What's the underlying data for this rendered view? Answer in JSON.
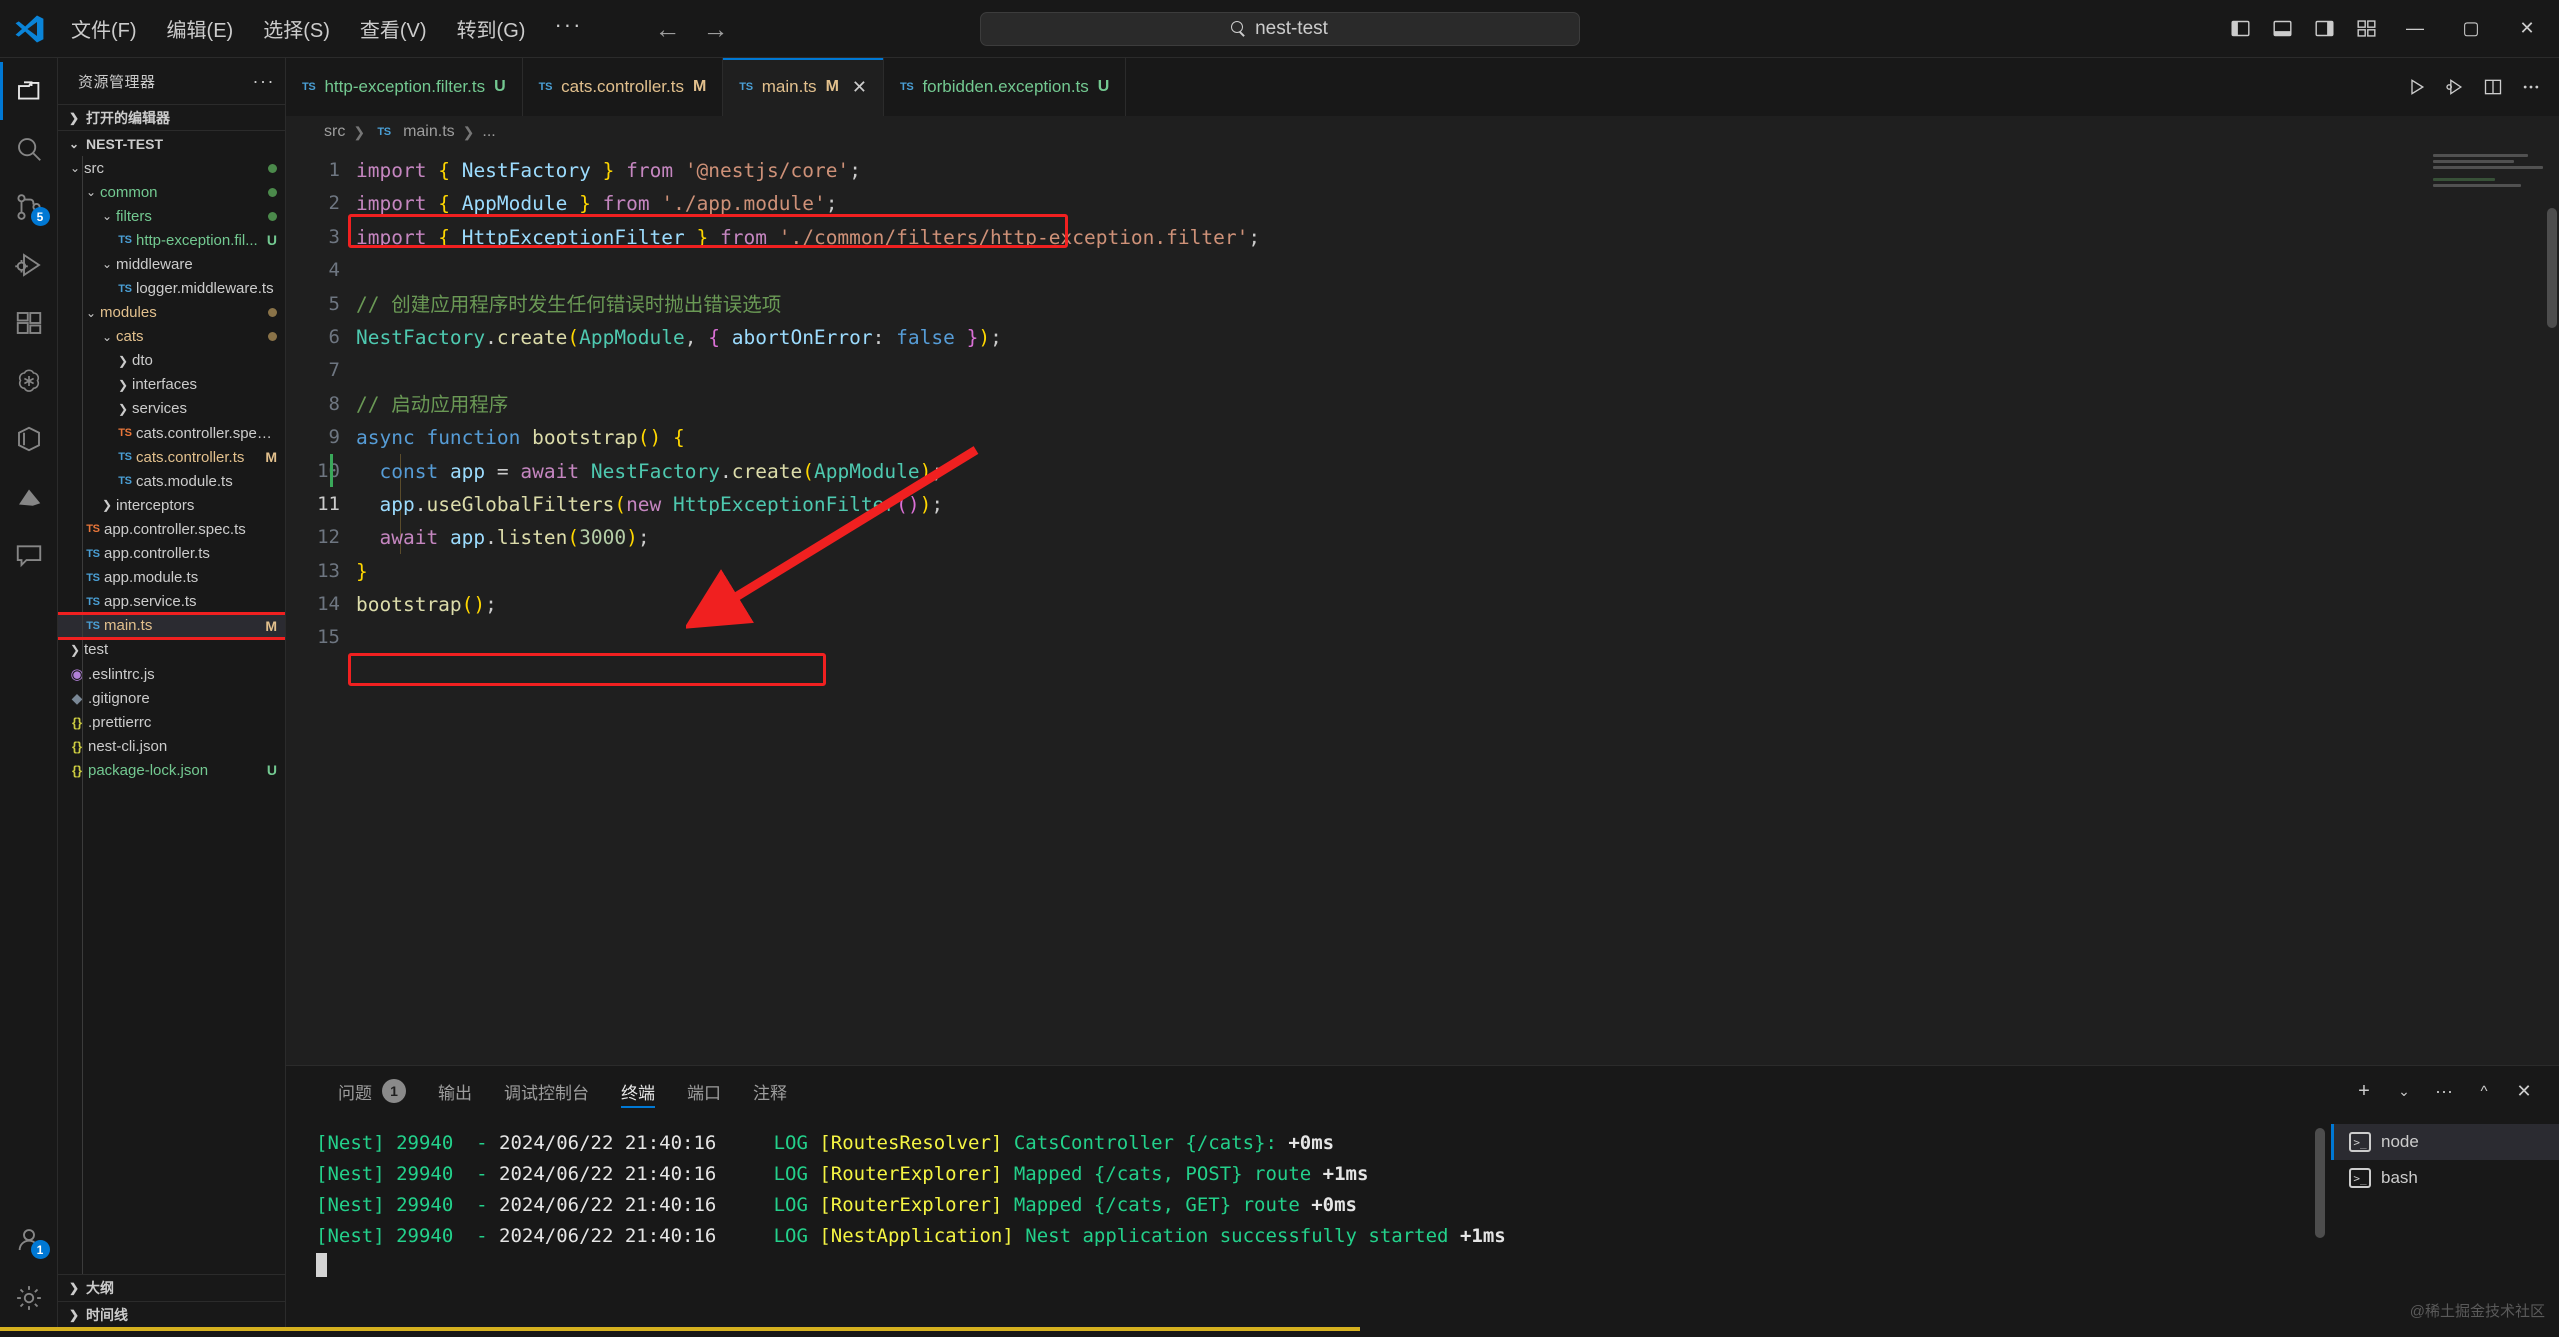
{
  "titlebar": {
    "menus": [
      "文件(F)",
      "编辑(E)",
      "选择(S)",
      "查看(V)",
      "转到(G)"
    ],
    "more": "···",
    "back_icon": "←",
    "forward_icon": "→",
    "command_center_text": "nest-test",
    "search_icon": "search-icon",
    "window_minimize": "—",
    "window_maximize": "▢",
    "window_close": "✕"
  },
  "activitybar": {
    "items": [
      {
        "name": "explorer",
        "icon": "files-icon",
        "active": true,
        "badge": ""
      },
      {
        "name": "search",
        "icon": "search-icon",
        "active": false,
        "badge": ""
      },
      {
        "name": "source-control",
        "icon": "source-control-icon",
        "active": false,
        "badge": "5"
      },
      {
        "name": "run-and-debug",
        "icon": "debug-icon",
        "active": false,
        "badge": ""
      },
      {
        "name": "extensions",
        "icon": "extensions-icon",
        "active": false,
        "badge": ""
      },
      {
        "name": "chatgpt",
        "icon": "openai-icon",
        "active": false,
        "badge": ""
      },
      {
        "name": "docker",
        "icon": "cube-icon",
        "active": false,
        "badge": ""
      },
      {
        "name": "nest",
        "icon": "nest-icon",
        "active": false,
        "badge": ""
      },
      {
        "name": "comments",
        "icon": "comment-icon",
        "active": false,
        "badge": ""
      }
    ],
    "bottom": [
      {
        "name": "accounts",
        "icon": "account-icon",
        "badge": "1"
      },
      {
        "name": "settings",
        "icon": "gear-icon",
        "badge": ""
      }
    ]
  },
  "sidebar": {
    "title": "资源管理器",
    "more_icon": "···",
    "open_editors_label": "打开的编辑器",
    "project_label": "NEST-TEST",
    "outline_label": "大纲",
    "timeline_label": "时间线",
    "tree": [
      {
        "label": "src",
        "depth": 1,
        "type": "folder",
        "open": true,
        "dot": "#4b8a4b",
        "badge": ""
      },
      {
        "label": "common",
        "depth": 2,
        "type": "folder",
        "open": true,
        "dot": "#4b8a4b",
        "badge": "",
        "color": "#73c991"
      },
      {
        "label": "filters",
        "depth": 3,
        "type": "folder",
        "open": true,
        "dot": "#4b8a4b",
        "badge": "",
        "color": "#73c991"
      },
      {
        "label": "http-exception.fil...",
        "depth": 4,
        "type": "ts",
        "badge": "U",
        "color": "#73c991",
        "badge_color": "#73c991"
      },
      {
        "label": "middleware",
        "depth": 3,
        "type": "folder",
        "open": true,
        "badge": ""
      },
      {
        "label": "logger.middleware.ts",
        "depth": 4,
        "type": "ts",
        "badge": ""
      },
      {
        "label": "modules",
        "depth": 2,
        "type": "folder",
        "open": true,
        "dot": "#8a7348",
        "badge": "",
        "color": "#e2c08d"
      },
      {
        "label": "cats",
        "depth": 3,
        "type": "folder",
        "open": true,
        "dot": "#8a7348",
        "badge": "",
        "color": "#e2c08d"
      },
      {
        "label": "dto",
        "depth": 4,
        "type": "folder",
        "open": false,
        "badge": ""
      },
      {
        "label": "interfaces",
        "depth": 4,
        "type": "folder",
        "open": false,
        "badge": ""
      },
      {
        "label": "services",
        "depth": 4,
        "type": "folder",
        "open": false,
        "badge": ""
      },
      {
        "label": "cats.controller.spec.ts",
        "depth": 4,
        "type": "ts-spec",
        "badge": ""
      },
      {
        "label": "cats.controller.ts",
        "depth": 4,
        "type": "ts",
        "badge": "M",
        "color": "#e2c08d",
        "badge_color": "#e2c08d"
      },
      {
        "label": "cats.module.ts",
        "depth": 4,
        "type": "ts",
        "badge": ""
      },
      {
        "label": "interceptors",
        "depth": 3,
        "type": "folder",
        "open": false,
        "badge": ""
      },
      {
        "label": "app.controller.spec.ts",
        "depth": 2,
        "type": "ts-spec",
        "badge": ""
      },
      {
        "label": "app.controller.ts",
        "depth": 2,
        "type": "ts",
        "badge": ""
      },
      {
        "label": "app.module.ts",
        "depth": 2,
        "type": "ts",
        "badge": ""
      },
      {
        "label": "app.service.ts",
        "depth": 2,
        "type": "ts",
        "badge": ""
      },
      {
        "label": "main.ts",
        "depth": 2,
        "type": "ts",
        "badge": "M",
        "color": "#e2c08d",
        "badge_color": "#e2c08d",
        "selected": true,
        "highlighted": true
      },
      {
        "label": "test",
        "depth": 1,
        "type": "folder",
        "open": false,
        "badge": ""
      },
      {
        "label": ".eslintrc.js",
        "depth": 1,
        "type": "eslint",
        "badge": ""
      },
      {
        "label": ".gitignore",
        "depth": 1,
        "type": "git",
        "badge": ""
      },
      {
        "label": ".prettierrc",
        "depth": 1,
        "type": "json",
        "badge": ""
      },
      {
        "label": "nest-cli.json",
        "depth": 1,
        "type": "json",
        "badge": ""
      },
      {
        "label": "package-lock.json",
        "depth": 1,
        "type": "json",
        "badge": "U",
        "color": "#73c991",
        "badge_color": "#73c991"
      }
    ]
  },
  "editor": {
    "tabs": [
      {
        "label": "http-exception.filter.ts",
        "badge": "U",
        "active": false,
        "color": "#73c991",
        "icon": "ts-icon"
      },
      {
        "label": "cats.controller.ts",
        "badge": "M",
        "active": false,
        "color": "#e2c08d",
        "icon": "ts-icon"
      },
      {
        "label": "main.ts",
        "badge": "M",
        "active": true,
        "color": "#e2c08d",
        "icon": "ts-icon",
        "close": "✕"
      },
      {
        "label": "forbidden.exception.ts",
        "badge": "U",
        "active": false,
        "color": "#73c991",
        "icon": "ts-icon"
      }
    ],
    "actions": [
      {
        "name": "run-file",
        "icon": "play-icon"
      },
      {
        "name": "run-and-debug",
        "icon": "debug-alt-icon"
      },
      {
        "name": "split-editor",
        "icon": "split-editor-icon"
      },
      {
        "name": "more-actions",
        "icon": "ellipsis-icon"
      }
    ],
    "breadcrumb": [
      "src",
      "main.ts",
      "..."
    ],
    "breadcrumb_file_icon": "ts-icon",
    "line_numbers": [
      "1",
      "2",
      "3",
      "4",
      "5",
      "6",
      "7",
      "8",
      "9",
      "10",
      "11",
      "12",
      "13",
      "14",
      "15"
    ],
    "current_line": 11,
    "code_lines": [
      {
        "n": 1,
        "tokens": [
          {
            "t": "import",
            "c": "kw"
          },
          {
            "t": " ",
            "c": "op"
          },
          {
            "t": "{",
            "c": "p1"
          },
          {
            "t": " ",
            "c": "op"
          },
          {
            "t": "NestFactory",
            "c": "var"
          },
          {
            "t": " ",
            "c": "op"
          },
          {
            "t": "}",
            "c": "p1"
          },
          {
            "t": " ",
            "c": "op"
          },
          {
            "t": "from",
            "c": "kw"
          },
          {
            "t": " ",
            "c": "op"
          },
          {
            "t": "'@nestjs/core'",
            "c": "str"
          },
          {
            "t": ";",
            "c": "op"
          }
        ]
      },
      {
        "n": 2,
        "tokens": [
          {
            "t": "import",
            "c": "kw"
          },
          {
            "t": " ",
            "c": "op"
          },
          {
            "t": "{",
            "c": "p1"
          },
          {
            "t": " ",
            "c": "op"
          },
          {
            "t": "AppModule",
            "c": "var"
          },
          {
            "t": " ",
            "c": "op"
          },
          {
            "t": "}",
            "c": "p1"
          },
          {
            "t": " ",
            "c": "op"
          },
          {
            "t": "from",
            "c": "kw"
          },
          {
            "t": " ",
            "c": "op"
          },
          {
            "t": "'./app.module'",
            "c": "str"
          },
          {
            "t": ";",
            "c": "op"
          }
        ]
      },
      {
        "n": 3,
        "tokens": [
          {
            "t": "import",
            "c": "kw"
          },
          {
            "t": " ",
            "c": "op"
          },
          {
            "t": "{",
            "c": "p1"
          },
          {
            "t": " ",
            "c": "op"
          },
          {
            "t": "HttpExceptionFilter",
            "c": "var"
          },
          {
            "t": " ",
            "c": "op"
          },
          {
            "t": "}",
            "c": "p1"
          },
          {
            "t": " ",
            "c": "op"
          },
          {
            "t": "from",
            "c": "kw"
          },
          {
            "t": " ",
            "c": "op"
          },
          {
            "t": "'./common/filters/http-exception.filter'",
            "c": "str"
          },
          {
            "t": ";",
            "c": "op"
          }
        ]
      },
      {
        "n": 4,
        "tokens": []
      },
      {
        "n": 5,
        "tokens": [
          {
            "t": "// 创建应用程序时发生任何错误时抛出错误选项",
            "c": "cmt"
          }
        ]
      },
      {
        "n": 6,
        "tokens": [
          {
            "t": "NestFactory",
            "c": "cls"
          },
          {
            "t": ".",
            "c": "op"
          },
          {
            "t": "create",
            "c": "fn"
          },
          {
            "t": "(",
            "c": "p1"
          },
          {
            "t": "AppModule",
            "c": "cls"
          },
          {
            "t": ", ",
            "c": "op"
          },
          {
            "t": "{",
            "c": "p2"
          },
          {
            "t": " ",
            "c": "op"
          },
          {
            "t": "abortOnError",
            "c": "var"
          },
          {
            "t": ": ",
            "c": "op"
          },
          {
            "t": "false",
            "c": "kw2"
          },
          {
            "t": " ",
            "c": "op"
          },
          {
            "t": "}",
            "c": "p2"
          },
          {
            "t": ")",
            "c": "p1"
          },
          {
            "t": ";",
            "c": "op"
          }
        ]
      },
      {
        "n": 7,
        "tokens": []
      },
      {
        "n": 8,
        "tokens": [
          {
            "t": "// 启动应用程序",
            "c": "cmt"
          }
        ]
      },
      {
        "n": 9,
        "tokens": [
          {
            "t": "async",
            "c": "kw2"
          },
          {
            "t": " ",
            "c": "op"
          },
          {
            "t": "function",
            "c": "kw2"
          },
          {
            "t": " ",
            "c": "op"
          },
          {
            "t": "bootstrap",
            "c": "fn"
          },
          {
            "t": "(",
            "c": "p1"
          },
          {
            "t": ")",
            "c": "p1"
          },
          {
            "t": " ",
            "c": "op"
          },
          {
            "t": "{",
            "c": "p1"
          }
        ]
      },
      {
        "n": 10,
        "tokens": [
          {
            "t": "  ",
            "c": "op"
          },
          {
            "t": "const",
            "c": "kw2"
          },
          {
            "t": " ",
            "c": "op"
          },
          {
            "t": "app",
            "c": "var"
          },
          {
            "t": " ",
            "c": "op"
          },
          {
            "t": "=",
            "c": "op"
          },
          {
            "t": " ",
            "c": "op"
          },
          {
            "t": "await",
            "c": "kw"
          },
          {
            "t": " ",
            "c": "op"
          },
          {
            "t": "NestFactory",
            "c": "cls"
          },
          {
            "t": ".",
            "c": "op"
          },
          {
            "t": "create",
            "c": "fn"
          },
          {
            "t": "(",
            "c": "p1"
          },
          {
            "t": "AppModule",
            "c": "cls"
          },
          {
            "t": ")",
            "c": "p1"
          },
          {
            "t": ";",
            "c": "op"
          }
        ]
      },
      {
        "n": 11,
        "tokens": [
          {
            "t": "  ",
            "c": "op"
          },
          {
            "t": "app",
            "c": "var"
          },
          {
            "t": ".",
            "c": "op"
          },
          {
            "t": "useGlobalFilters",
            "c": "fn"
          },
          {
            "t": "(",
            "c": "p1"
          },
          {
            "t": "new",
            "c": "kw"
          },
          {
            "t": " ",
            "c": "op"
          },
          {
            "t": "HttpExceptionFilter",
            "c": "cls"
          },
          {
            "t": "(",
            "c": "p2"
          },
          {
            "t": ")",
            "c": "p2"
          },
          {
            "t": ")",
            "c": "p1"
          },
          {
            "t": ";",
            "c": "op"
          }
        ]
      },
      {
        "n": 12,
        "tokens": [
          {
            "t": "  ",
            "c": "op"
          },
          {
            "t": "await",
            "c": "kw"
          },
          {
            "t": " ",
            "c": "op"
          },
          {
            "t": "app",
            "c": "var"
          },
          {
            "t": ".",
            "c": "op"
          },
          {
            "t": "listen",
            "c": "fn"
          },
          {
            "t": "(",
            "c": "p1"
          },
          {
            "t": "3000",
            "c": "num"
          },
          {
            "t": ")",
            "c": "p1"
          },
          {
            "t": ";",
            "c": "op"
          }
        ]
      },
      {
        "n": 13,
        "tokens": [
          {
            "t": "}",
            "c": "p1"
          }
        ]
      },
      {
        "n": 14,
        "tokens": [
          {
            "t": "bootstrap",
            "c": "fn"
          },
          {
            "t": "(",
            "c": "p1"
          },
          {
            "t": ")",
            "c": "p1"
          },
          {
            "t": ";",
            "c": "op"
          }
        ]
      },
      {
        "n": 15,
        "tokens": []
      }
    ],
    "annotations": {
      "highlight_boxes": [
        "import-httpexceptionfilter-line3",
        "useglobalfilters-line11",
        "main-ts-sidebar-entry"
      ],
      "arrow": "red-arrow-pointing-to-line11"
    }
  },
  "panel": {
    "tabs": [
      {
        "label": "问题",
        "count": "1",
        "active": false
      },
      {
        "label": "输出",
        "count": "",
        "active": false
      },
      {
        "label": "调试控制台",
        "count": "",
        "active": false
      },
      {
        "label": "终端",
        "count": "",
        "active": true
      },
      {
        "label": "端口",
        "count": "",
        "active": false
      },
      {
        "label": "注释",
        "count": "",
        "active": false
      }
    ],
    "actions": [
      {
        "name": "new-terminal",
        "icon": "plus-icon"
      },
      {
        "name": "terminal-dropdown",
        "icon": "chevron-down-icon"
      },
      {
        "name": "panel-more",
        "icon": "ellipsis-icon"
      },
      {
        "name": "maximize-panel",
        "icon": "chevron-up-icon"
      },
      {
        "name": "close-panel",
        "icon": "close-icon"
      }
    ],
    "terminal_lines": [
      {
        "segments": [
          {
            "t": "[Nest] 29940  - ",
            "c": "t-green"
          },
          {
            "t": "2024/06/22 21:40:16",
            "c": "t-white"
          },
          {
            "t": "     ",
            "c": "t-white"
          },
          {
            "t": "LOG ",
            "c": "t-green"
          },
          {
            "t": "[RoutesResolver] ",
            "c": "t-yellow"
          },
          {
            "t": "CatsController {/cats}: ",
            "c": "t-green"
          },
          {
            "t": "+0ms",
            "c": "t-white t-bold"
          }
        ]
      },
      {
        "segments": [
          {
            "t": "[Nest] 29940  - ",
            "c": "t-green"
          },
          {
            "t": "2024/06/22 21:40:16",
            "c": "t-white"
          },
          {
            "t": "     ",
            "c": "t-white"
          },
          {
            "t": "LOG ",
            "c": "t-green"
          },
          {
            "t": "[RouterExplorer] ",
            "c": "t-yellow"
          },
          {
            "t": "Mapped {/cats, POST} route ",
            "c": "t-green"
          },
          {
            "t": "+1ms",
            "c": "t-white t-bold"
          }
        ]
      },
      {
        "segments": [
          {
            "t": "[Nest] 29940  - ",
            "c": "t-green"
          },
          {
            "t": "2024/06/22 21:40:16",
            "c": "t-white"
          },
          {
            "t": "     ",
            "c": "t-white"
          },
          {
            "t": "LOG ",
            "c": "t-green"
          },
          {
            "t": "[RouterExplorer] ",
            "c": "t-yellow"
          },
          {
            "t": "Mapped {/cats, GET} route ",
            "c": "t-green"
          },
          {
            "t": "+0ms",
            "c": "t-white t-bold"
          }
        ]
      },
      {
        "segments": [
          {
            "t": "[Nest] 29940  - ",
            "c": "t-green"
          },
          {
            "t": "2024/06/22 21:40:16",
            "c": "t-white"
          },
          {
            "t": "     ",
            "c": "t-white"
          },
          {
            "t": "LOG ",
            "c": "t-green"
          },
          {
            "t": "[NestApplication] ",
            "c": "t-yellow"
          },
          {
            "t": "Nest application successfully started ",
            "c": "t-green"
          },
          {
            "t": "+1ms",
            "c": "t-white t-bold"
          }
        ]
      }
    ],
    "terminal_instances": [
      {
        "label": "node",
        "active": true,
        "icon": "terminal-icon"
      },
      {
        "label": "bash",
        "active": false,
        "icon": "terminal-icon"
      }
    ]
  },
  "watermark": "@稀土掘金技术社区",
  "colors": {
    "accent": "#0078d4",
    "highlight_red": "#f02020",
    "modified_badge": "#e2c08d",
    "untracked_badge": "#73c991",
    "terminal_green": "#23d18b",
    "terminal_yellow": "#f5f543"
  }
}
